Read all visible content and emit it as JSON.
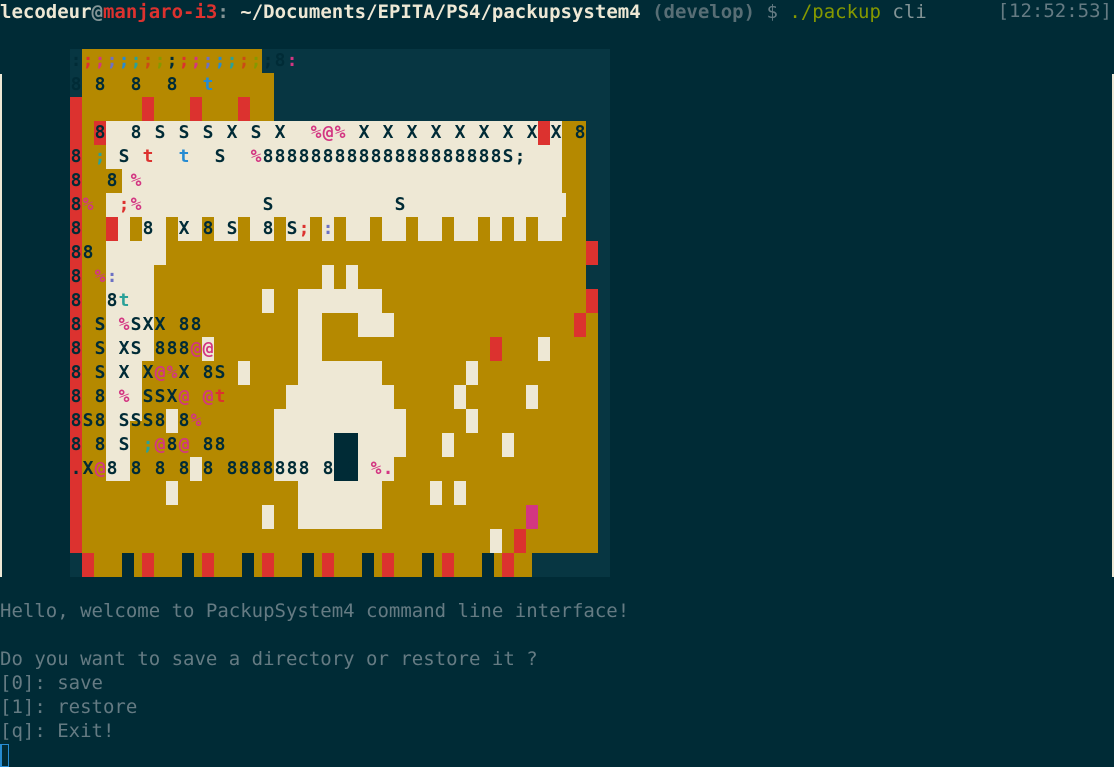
{
  "prompt": {
    "user": "lecodeur",
    "at": "@",
    "host": "manjaro-i3",
    "colon": ":",
    "path": "~/Documents/EPITA/PS4/packupsystem4",
    "branch": "(develop)",
    "dollar": "$",
    "command": "./packup",
    "args": "cli",
    "timestamp": "[12:52:53]"
  },
  "art": {
    "colors": {
      "background": "#073642",
      "gold": "#b58900",
      "cream": "#eee8d5",
      "red": "#dc322f",
      "magenta": "#d33682",
      "violet": "#6c71c4",
      "blue": "#268bd2",
      "cyan": "#2aa198",
      "green": "#859900",
      "orange": "#cb4b16",
      "dark": "#002b36"
    },
    "glyph_rows": [
      {
        "glyphs": ":;;;;;;;;;;;;;;;;8:"
      },
      {
        "glyphs": "8 8  8  8  t"
      },
      {
        "glyphs": "8  8 S S S X S X  %@% X X X X X X X X X 8"
      },
      {
        "glyphs": "8 ; S t  t  S  %88888888888888888888S;"
      },
      {
        "glyphs": "8  8 %"
      },
      {
        "glyphs": "8%  ;%          S          S"
      },
      {
        "glyphs": "8  t  8  X 8 S  8 S; :"
      },
      {
        "glyphs": "88"
      },
      {
        "glyphs": "8 %:"
      },
      {
        "glyphs": "8  8t"
      },
      {
        "glyphs": "8 S %SXX 88"
      },
      {
        "glyphs": "8 S XS 888@@"
      },
      {
        "glyphs": "8 S X X@%X 8S"
      },
      {
        "glyphs": "8 8 % SSX@ @t"
      },
      {
        "glyphs": "8S8 SSS8 8%"
      },
      {
        "glyphs": "8 8 S ;@8@ 88"
      },
      {
        "glyphs": ".X@8 8 8 8 8 8888888 8 8 %."
      }
    ]
  },
  "output": {
    "welcome": "Hello, welcome to PackupSystem4 command line interface!",
    "question": "Do you want to save a directory or restore it ?",
    "options": [
      "[0]: save",
      "[1]: restore",
      "[q]: Exit!"
    ]
  }
}
